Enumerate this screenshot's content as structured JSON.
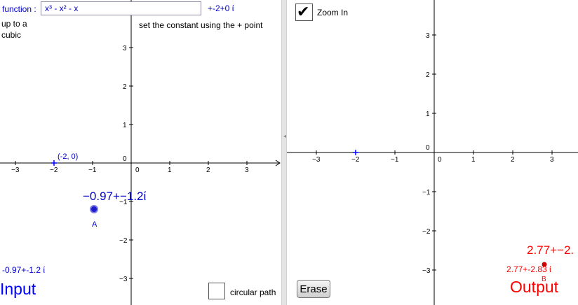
{
  "colors": {
    "input_blue": "#0000ff",
    "value_blue": "#0000cc",
    "output_red": "#ff0000",
    "axis": "#000000"
  },
  "left_panel": {
    "function_label": "function :",
    "function_value": "x³ - x² - x",
    "constant_value": "+-2+0 ί",
    "note_up_to": "up to a cubic",
    "note_constant": "set the constant using the + point",
    "constant_point_label": "(-2, 0)",
    "point_a_value": "−0.97+−1.2ί",
    "point_a_label": "A",
    "bottom_value": "-0.97+-1.2 ί",
    "input_title": "Input",
    "circular_path_label": "circular path",
    "circular_path_checked": false,
    "x_ticks": [
      "−3",
      "−2",
      "−1",
      "0",
      "1",
      "2",
      "3"
    ],
    "y_ticks": [
      "3",
      "2",
      "1",
      "0",
      "−1",
      "−2",
      "−3"
    ]
  },
  "right_panel": {
    "zoom_label": "Zoom In",
    "zoom_checked": true,
    "check_icon": "✔",
    "erase_label": "Erase",
    "output_value_top": "2.77+−2.",
    "output_value_small": "2.77+-2.83 ί",
    "point_b_label": "B",
    "output_title": "Output",
    "x_ticks": [
      "−3",
      "−2",
      "−1",
      "0",
      "1",
      "2",
      "3"
    ],
    "y_ticks": [
      "3",
      "2",
      "1",
      "0",
      "−1",
      "−2",
      "−3"
    ]
  }
}
